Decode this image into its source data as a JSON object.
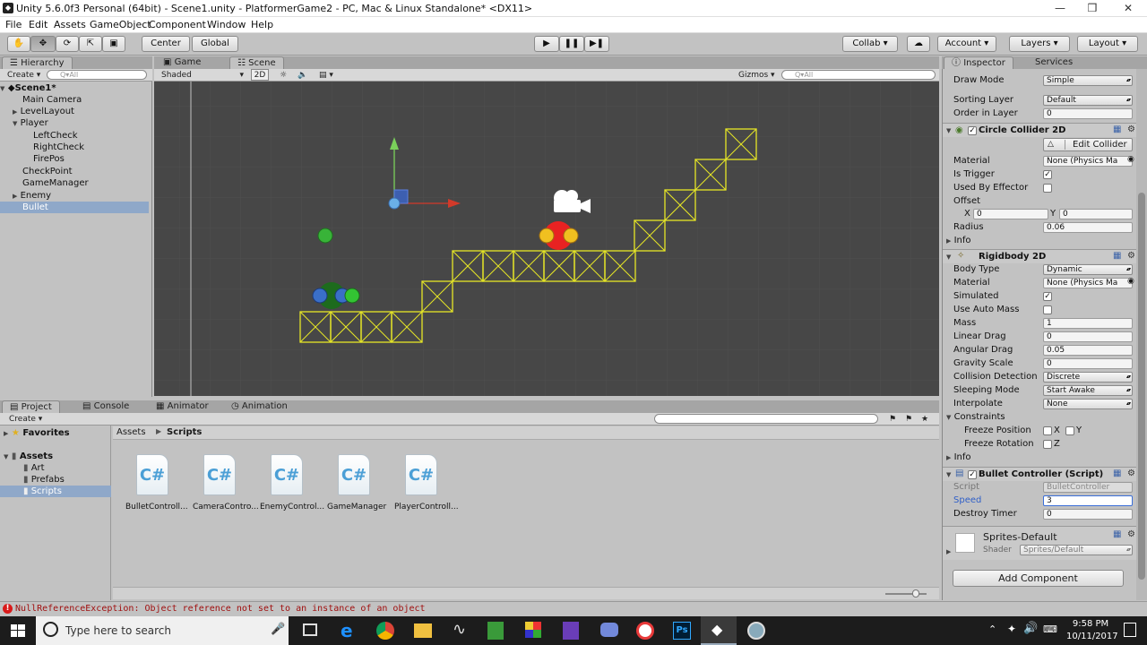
{
  "window": {
    "title": "Unity 5.6.0f3 Personal (64bit) - Scene1.unity - PlatformerGame2 - PC, Mac & Linux Standalone* <DX11>",
    "minimize": "—",
    "maximize": "❒",
    "close": "✕"
  },
  "menu": [
    "File",
    "Edit",
    "Assets",
    "GameObject",
    "Component",
    "Window",
    "Help"
  ],
  "toolbar": {
    "center": "Center",
    "global": "Global",
    "collab": "Collab",
    "account": "Account",
    "layers": "Layers",
    "layout": "Layout"
  },
  "hierarchy": {
    "tab": "Hierarchy",
    "create": "Create",
    "search_placeholder": "Q▾All",
    "scene": "Scene1*",
    "items": [
      "Main Camera",
      "LevelLayout",
      "Player",
      "LeftCheck",
      "RightCheck",
      "FirePos",
      "CheckPoint",
      "GameManager",
      "Enemy",
      "Bullet"
    ]
  },
  "scene_view": {
    "tabs": [
      "Game",
      "Scene"
    ],
    "shaded": "Shaded",
    "mode2d": "2D",
    "gizmos": "Gizmos",
    "search_placeholder": "Q▾All"
  },
  "project": {
    "tabs": [
      "Project",
      "Console",
      "Animator",
      "Animation"
    ],
    "create": "Create",
    "favorites": "Favorites",
    "assets": "Assets",
    "folders": [
      "Art",
      "Prefabs",
      "Scripts"
    ],
    "breadcrumb": [
      "Assets",
      "Scripts"
    ],
    "files": [
      "BulletControll...",
      "CameraContro...",
      "EnemyControl...",
      "GameManager",
      "PlayerControll..."
    ],
    "file_icon_text": "C#"
  },
  "inspector": {
    "tabs": [
      "Inspector",
      "Services"
    ],
    "sprite_renderer": {
      "draw_mode_label": "Draw Mode",
      "draw_mode": "Simple",
      "sorting_layer_label": "Sorting Layer",
      "sorting_layer": "Default",
      "order_label": "Order in Layer",
      "order": "0"
    },
    "circle_collider": {
      "title": "Circle Collider 2D",
      "edit_collider": "Edit Collider",
      "material_label": "Material",
      "material": "None (Physics Ma",
      "is_trigger_label": "Is Trigger",
      "used_by_effector_label": "Used By Effector",
      "offset_label": "Offset",
      "x_label": "X",
      "x": "0",
      "y_label": "Y",
      "y": "0",
      "radius_label": "Radius",
      "radius": "0.06",
      "info_label": "Info"
    },
    "rigidbody": {
      "title": "Rigidbody 2D",
      "body_type_label": "Body Type",
      "body_type": "Dynamic",
      "material_label": "Material",
      "material": "None (Physics Ma",
      "simulated_label": "Simulated",
      "auto_mass_label": "Use Auto Mass",
      "mass_label": "Mass",
      "mass": "1",
      "linear_drag_label": "Linear Drag",
      "linear_drag": "0",
      "angular_drag_label": "Angular Drag",
      "angular_drag": "0.05",
      "gravity_label": "Gravity Scale",
      "gravity": "0",
      "collision_label": "Collision Detection",
      "collision": "Discrete",
      "sleeping_label": "Sleeping Mode",
      "sleeping": "Start Awake",
      "interpolate_label": "Interpolate",
      "interpolate": "None",
      "constraints_label": "Constraints",
      "freeze_pos_label": "Freeze Position",
      "freeze_rot_label": "Freeze Rotation",
      "x_label": "X",
      "y_label": "Y",
      "z_label": "Z",
      "info_label": "Info"
    },
    "bullet_controller": {
      "title": "Bullet Controller (Script)",
      "script_label": "Script",
      "script": "BulletController",
      "speed_label": "Speed",
      "speed": "3",
      "destroy_label": "Destroy Timer",
      "destroy": "0"
    },
    "material": {
      "name": "Sprites-Default",
      "shader_label": "Shader",
      "shader": "Sprites/Default"
    },
    "add_component": "Add Component"
  },
  "status": {
    "error": "NullReferenceException: Object reference not set to an instance of an object"
  },
  "taskbar": {
    "search_placeholder": "Type here to search",
    "time": "9:58 PM",
    "date": "10/11/2017"
  }
}
